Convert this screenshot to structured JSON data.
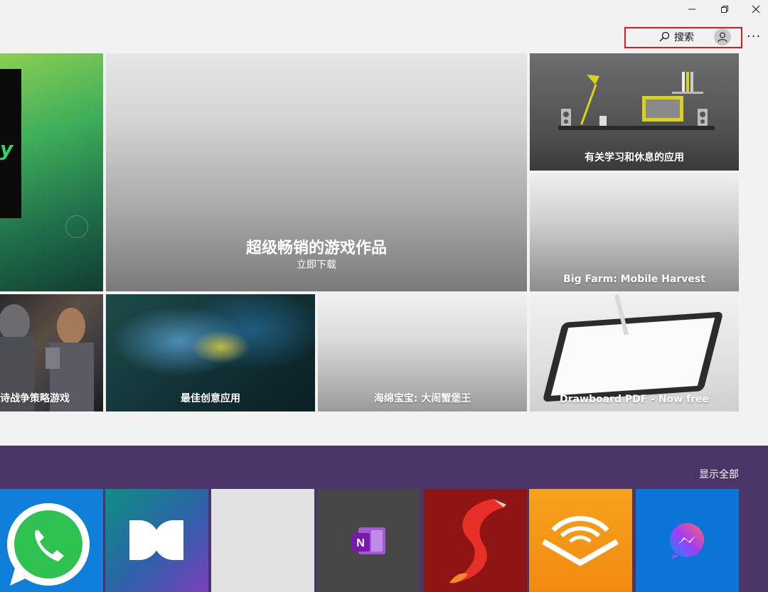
{
  "window": {
    "minimize_label": "",
    "restore_label": "",
    "close_label": ""
  },
  "header": {
    "search_label": "搜索",
    "more_label": "···"
  },
  "tiles": {
    "hero_title": "超级畅销的游戏作品",
    "hero_subtitle": "立即下载",
    "desk": "有关学习和休息的应用",
    "farm": "Big Farm: Mobile Harvest",
    "knight": "诗战争策略游戏",
    "art": "最佳创意应用",
    "sponge": "海绵宝宝: 大闹蟹堡王",
    "draw": "Drawboard PDF - Now free",
    "green_logo": "y"
  },
  "apps_section": {
    "show_all_label": "显示全部"
  },
  "colors": {
    "band": "#4a3468",
    "highlight": "#e8141d",
    "background": "#f2f2f2"
  }
}
